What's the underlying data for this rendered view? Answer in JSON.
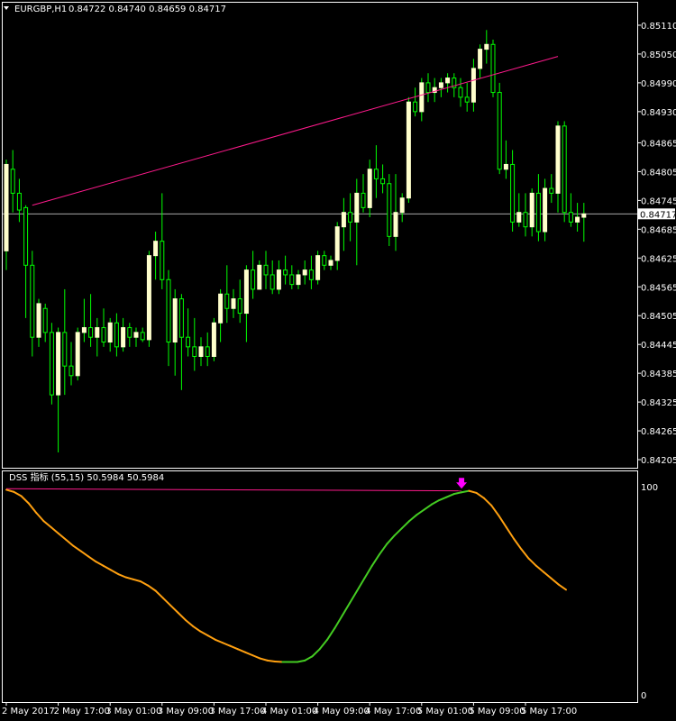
{
  "header": {
    "symbol": "EURGBP,H1",
    "ohlc": "0.84722 0.84740 0.84659 0.84717",
    "menu_icon": "triangle-down-icon"
  },
  "colors": {
    "background": "#000000",
    "border": "#ffffff",
    "bull_candle": "#ffffcc",
    "bear_candle": "#00ff00",
    "wick": "#00ff00",
    "trendline": "#ff1a8c",
    "price_line": "#c0c0c0",
    "osc_rising": "#44cc22",
    "osc_falling": "#ffa010",
    "signal_arrow": "#ff00ff"
  },
  "chart_data": [
    {
      "type": "candlestick",
      "title": "EURGBP,H1",
      "ohlc_text": "0.84722 0.84740 0.84659 0.84717",
      "current_price": 0.84717,
      "current_price_label": "0.84717",
      "ylim": [
        0.84175,
        0.8514
      ],
      "y_tick_labels": [
        "0.85110",
        "0.85050",
        "0.84990",
        "0.84930",
        "0.84865",
        "0.84805",
        "0.84745",
        "0.84685",
        "0.84625",
        "0.84565",
        "0.84505",
        "0.84445",
        "0.84385",
        "0.84325",
        "0.84265",
        "0.84205"
      ],
      "y_tick_values": [
        0.8511,
        0.8505,
        0.8499,
        0.8493,
        0.84865,
        0.84805,
        0.84745,
        0.84685,
        0.84625,
        0.84565,
        0.84505,
        0.84445,
        0.84385,
        0.84325,
        0.84265,
        0.84205
      ],
      "x_tick_labels": [
        "2 May 2017",
        "2 May 17:00",
        "3 May 01:00",
        "3 May 09:00",
        "3 May 17:00",
        "4 May 01:00",
        "4 May 09:00",
        "4 May 17:00",
        "5 May 01:00",
        "5 May 09:00",
        "5 May 17:00"
      ],
      "x_tick_bar_index": [
        0,
        8,
        16,
        24,
        32,
        40,
        48,
        56,
        64,
        72,
        80
      ],
      "bars": [
        [
          0.8464,
          0.8483,
          0.846,
          0.8482
        ],
        [
          0.8481,
          0.8485,
          0.8472,
          0.8476
        ],
        [
          0.8476,
          0.8479,
          0.847,
          0.84725
        ],
        [
          0.8473,
          0.84735,
          0.845,
          0.8461
        ],
        [
          0.8461,
          0.8464,
          0.8442,
          0.8446
        ],
        [
          0.8446,
          0.8454,
          0.8444,
          0.8453
        ],
        [
          0.8452,
          0.8453,
          0.8445,
          0.8447
        ],
        [
          0.8447,
          0.8449,
          0.8432,
          0.8434
        ],
        [
          0.8434,
          0.8448,
          0.8422,
          0.8447
        ],
        [
          0.8447,
          0.8456,
          0.8434,
          0.844
        ],
        [
          0.844,
          0.8445,
          0.8436,
          0.8438
        ],
        [
          0.8438,
          0.8448,
          0.8437,
          0.8447
        ],
        [
          0.8447,
          0.8454,
          0.8445,
          0.8448
        ],
        [
          0.8448,
          0.8455,
          0.8444,
          0.8446
        ],
        [
          0.8446,
          0.845,
          0.8442,
          0.8448
        ],
        [
          0.8448,
          0.8452,
          0.8444,
          0.8445
        ],
        [
          0.8445,
          0.845,
          0.8443,
          0.8449
        ],
        [
          0.8449,
          0.8451,
          0.8442,
          0.8444
        ],
        [
          0.8444,
          0.845,
          0.8443,
          0.8448
        ],
        [
          0.8448,
          0.8449,
          0.8444,
          0.8446
        ],
        [
          0.8446,
          0.8448,
          0.8444,
          0.8447
        ],
        [
          0.8447,
          0.8448,
          0.8445,
          0.84455
        ],
        [
          0.84455,
          0.8464,
          0.8444,
          0.8463
        ],
        [
          0.8463,
          0.8468,
          0.8458,
          0.8466
        ],
        [
          0.8466,
          0.8476,
          0.8456,
          0.8458
        ],
        [
          0.8458,
          0.846,
          0.844,
          0.8445
        ],
        [
          0.8445,
          0.8456,
          0.8438,
          0.8454
        ],
        [
          0.8454,
          0.8455,
          0.8435,
          0.8446
        ],
        [
          0.8446,
          0.8452,
          0.8442,
          0.8444
        ],
        [
          0.8444,
          0.845,
          0.8439,
          0.8442
        ],
        [
          0.8442,
          0.8446,
          0.844,
          0.8444
        ],
        [
          0.8444,
          0.8447,
          0.844,
          0.8442
        ],
        [
          0.8442,
          0.845,
          0.8441,
          0.8449
        ],
        [
          0.8449,
          0.8456,
          0.8445,
          0.8455
        ],
        [
          0.8455,
          0.8461,
          0.8449,
          0.8452
        ],
        [
          0.8452,
          0.8456,
          0.845,
          0.8454
        ],
        [
          0.8454,
          0.8458,
          0.8449,
          0.8451
        ],
        [
          0.8451,
          0.8461,
          0.8445,
          0.846
        ],
        [
          0.846,
          0.8464,
          0.8454,
          0.8456
        ],
        [
          0.8456,
          0.8462,
          0.8456,
          0.8461
        ],
        [
          0.8461,
          0.8464,
          0.8456,
          0.8459
        ],
        [
          0.8459,
          0.8462,
          0.8455,
          0.8456
        ],
        [
          0.8456,
          0.8462,
          0.8455,
          0.846
        ],
        [
          0.846,
          0.8463,
          0.8457,
          0.8459
        ],
        [
          0.8459,
          0.8461,
          0.8456,
          0.8457
        ],
        [
          0.8457,
          0.846,
          0.8456,
          0.8459
        ],
        [
          0.8459,
          0.8462,
          0.8457,
          0.846
        ],
        [
          0.846,
          0.8463,
          0.8456,
          0.8458
        ],
        [
          0.8458,
          0.8464,
          0.8457,
          0.8463
        ],
        [
          0.8463,
          0.8464,
          0.846,
          0.8461
        ],
        [
          0.8461,
          0.8463,
          0.846,
          0.8462
        ],
        [
          0.8462,
          0.847,
          0.846,
          0.8469
        ],
        [
          0.8469,
          0.8475,
          0.8464,
          0.8472
        ],
        [
          0.8472,
          0.8476,
          0.8466,
          0.847
        ],
        [
          0.847,
          0.8479,
          0.8461,
          0.8476
        ],
        [
          0.8476,
          0.848,
          0.8472,
          0.8473
        ],
        [
          0.8473,
          0.8483,
          0.8471,
          0.8481
        ],
        [
          0.8481,
          0.8486,
          0.8475,
          0.8479
        ],
        [
          0.8479,
          0.8482,
          0.8476,
          0.8478
        ],
        [
          0.8478,
          0.848,
          0.8465,
          0.8467
        ],
        [
          0.8467,
          0.848,
          0.8464,
          0.8472
        ],
        [
          0.8472,
          0.8476,
          0.847,
          0.8475
        ],
        [
          0.8475,
          0.8496,
          0.8474,
          0.8495
        ],
        [
          0.8495,
          0.8498,
          0.8492,
          0.8493
        ],
        [
          0.8493,
          0.85,
          0.8491,
          0.8499
        ],
        [
          0.8499,
          0.8501,
          0.8495,
          0.8497
        ],
        [
          0.8497,
          0.85,
          0.8495,
          0.8498
        ],
        [
          0.8498,
          0.85,
          0.8496,
          0.8499
        ],
        [
          0.8499,
          0.8501,
          0.8497,
          0.85
        ],
        [
          0.85,
          0.8501,
          0.8496,
          0.8498
        ],
        [
          0.8498,
          0.85,
          0.8494,
          0.8496
        ],
        [
          0.8496,
          0.8499,
          0.8493,
          0.8495
        ],
        [
          0.8495,
          0.8504,
          0.8493,
          0.8502
        ],
        [
          0.8502,
          0.8507,
          0.85,
          0.8506
        ],
        [
          0.8506,
          0.851,
          0.8503,
          0.8507
        ],
        [
          0.8507,
          0.8508,
          0.8496,
          0.8497
        ],
        [
          0.8497,
          0.8499,
          0.848,
          0.8481
        ],
        [
          0.8481,
          0.8487,
          0.8479,
          0.8482
        ],
        [
          0.8482,
          0.8485,
          0.8468,
          0.847
        ],
        [
          0.847,
          0.8476,
          0.8469,
          0.8472
        ],
        [
          0.8472,
          0.8476,
          0.8467,
          0.8469
        ],
        [
          0.8469,
          0.8477,
          0.8467,
          0.8476
        ],
        [
          0.8476,
          0.848,
          0.8466,
          0.8468
        ],
        [
          0.8468,
          0.8479,
          0.8466,
          0.8477
        ],
        [
          0.8477,
          0.848,
          0.8474,
          0.8476
        ],
        [
          0.8476,
          0.8491,
          0.8472,
          0.849
        ],
        [
          0.849,
          0.8491,
          0.847,
          0.8472
        ],
        [
          0.8472,
          0.8476,
          0.8469,
          0.847
        ],
        [
          0.847,
          0.8474,
          0.8468,
          0.8471
        ],
        [
          0.8471,
          0.8474,
          0.84659,
          0.84717
        ]
      ],
      "trendline": [
        {
          "bar": 4,
          "price": 0.84735
        },
        {
          "bar": 85,
          "price": 0.85045
        }
      ]
    },
    {
      "type": "line",
      "title": "DSS 指标 (55,15) 50.5984 50.5984",
      "ylim": [
        0,
        100
      ],
      "y_tick_labels": [
        "100",
        "0"
      ],
      "y_tick_values": [
        100,
        0
      ],
      "values": [
        98.5,
        97.5,
        95.5,
        92.0,
        87.5,
        83.5,
        80.5,
        77.5,
        74.5,
        71.5,
        69.0,
        66.5,
        64.0,
        62.0,
        60.0,
        58.0,
        56.5,
        55.5,
        54.5,
        52.5,
        50.0,
        46.5,
        43.0,
        39.5,
        36.0,
        33.0,
        30.5,
        28.5,
        26.5,
        25.0,
        23.5,
        22.0,
        20.5,
        19.0,
        17.5,
        16.5,
        16.0,
        15.8,
        15.8,
        15.8,
        16.5,
        18.5,
        22.0,
        26.5,
        32.0,
        38.0,
        44.0,
        50.0,
        56.0,
        62.0,
        67.5,
        72.5,
        76.5,
        80.0,
        83.5,
        86.5,
        89.0,
        91.5,
        93.5,
        95.0,
        96.5,
        97.3,
        98.0,
        97.0,
        94.5,
        91.0,
        86.0,
        80.5,
        75.0,
        70.0,
        65.5,
        62.0,
        59.0,
        56.0,
        53.0,
        50.5
      ],
      "values_bar_offset": 0,
      "values_bar_step": 1.15,
      "signal_index": 61,
      "trendline": [
        {
          "bar": 0,
          "value": 99.0
        },
        {
          "bar": 61,
          "value": 98.0
        }
      ]
    }
  ]
}
